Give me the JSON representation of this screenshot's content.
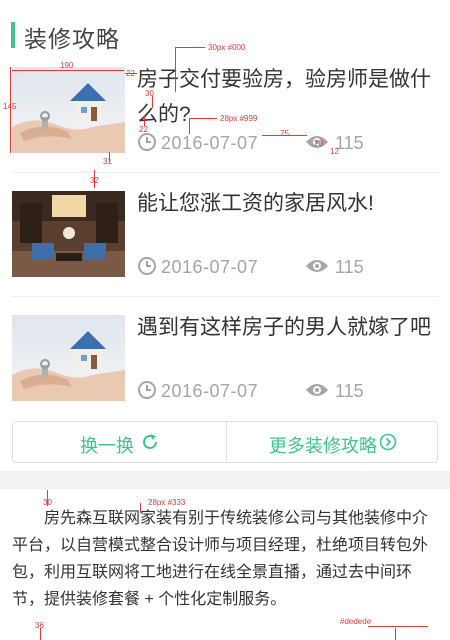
{
  "section": {
    "title": "装修攻略"
  },
  "articles": [
    {
      "title": "房子交付要验房，验房师是做什么的?",
      "date": "2016-07-07",
      "views": "115",
      "image": "hands-holding-house-photo"
    },
    {
      "title": "能让您涨工资的家居风水!",
      "date": "2016-07-07",
      "views": "115",
      "image": "living-room-photo"
    },
    {
      "title": "遇到有这样房子的男人就嫁了吧",
      "date": "2016-07-07",
      "views": "115",
      "image": "hands-holding-house-photo"
    }
  ],
  "actions": {
    "refresh_label": "换一换",
    "more_label": "更多装修攻略"
  },
  "intro": {
    "text": "房先森互联网家装有别于传统装修公司与其他装修中介平台，以自营模式整合设计师与项目经理，杜绝项目转包外包，利用互联网将工地进行在线全景直播，通过去中间环节，提供装修套餐 + 个性化定制服务。"
  },
  "annotations": {
    "a1": "30px #000",
    "a2": "190",
    "a3": "22",
    "a4": "145",
    "a5": "30",
    "a6": "22",
    "a7": "28px #999",
    "a8": "75",
    "a9": "28",
    "a10": "12",
    "a11": "31",
    "a12": "32",
    "a13": "30",
    "a14": "28px #333",
    "a15": "36",
    "a16": "#dedede"
  },
  "colors": {
    "accent": "#3cc48a",
    "meta": "#a5a5a5",
    "annotation": "#e23a3a",
    "divider": "#efefef"
  }
}
